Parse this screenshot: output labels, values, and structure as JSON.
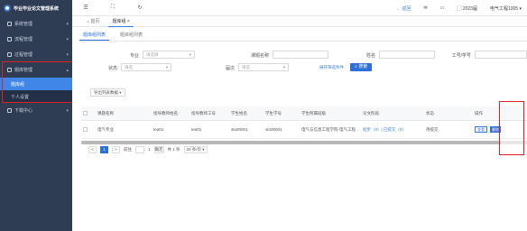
{
  "sidebar": {
    "logo_text": "毕业毕业论文管理系统",
    "items": [
      {
        "label": "系统管理"
      },
      {
        "label": "流程管理"
      },
      {
        "label": "过程管理"
      },
      {
        "label": "题库管理"
      }
    ],
    "sub_items": [
      {
        "label": "题库组"
      },
      {
        "label": "个人设置"
      }
    ],
    "bottom_item": {
      "label": "下载中心"
    }
  },
  "topbar": {
    "back_label": "返回",
    "year_label": "2023届",
    "user_label": "电气工程1005"
  },
  "tabs": [
    {
      "label": "首页"
    },
    {
      "label": "题库组"
    }
  ],
  "subtabs": [
    {
      "label": "题库组列表"
    },
    {
      "label": "题目组列表"
    }
  ],
  "filters": {
    "major_label": "专业",
    "major_placeholder": "请选择",
    "title_label": "课题名称",
    "name_label": "姓名",
    "id_label": "工号/学号",
    "status_label": "状态",
    "status_placeholder": "请选",
    "batch_label": "届次",
    "batch_placeholder": "请选",
    "more_link": "展开筛选条件",
    "search_button": "搜索"
  },
  "export_button": "导出列表数据",
  "table": {
    "headers": [
      "课题名称",
      "指导教师姓名",
      "指导教师工号",
      "学生姓名",
      "学生学号",
      "学生所属班级",
      "论文阶段",
      "状态",
      "操作"
    ],
    "rows": [
      {
        "title": "电气专业",
        "teacher_name": "tea01",
        "teacher_id": "tea01",
        "student_name": "stu00001",
        "student_id": "stu00001",
        "class": "电气与信息工程学院-电气工程...",
        "stage": "初步（0）| 已提交（0）",
        "status": "待提交",
        "op_edit": "查看",
        "op_delete": "删除"
      }
    ]
  },
  "pager": {
    "prev": "<",
    "current": "1",
    "next": ">",
    "ellipsis": "...",
    "goto_label": "前往",
    "total_pages": "1",
    "confirm": "确定",
    "total": "共 1 条",
    "page_size": "20 条/页"
  }
}
